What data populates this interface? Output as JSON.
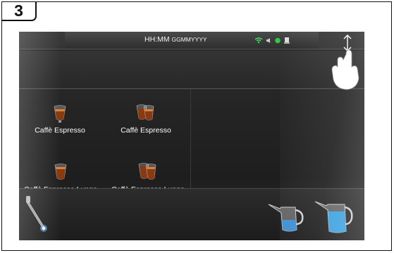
{
  "step": {
    "number": "3"
  },
  "status_bar": {
    "time": "HH:MM",
    "date": "GGMMYYYY",
    "icons": [
      "wifi-icon",
      "sound-icon",
      "status-dot-icon",
      "card-icon"
    ]
  },
  "beverages": [
    {
      "label": "Caffè Espresso"
    },
    {
      "label": "Caffè Espresso"
    },
    {
      "label": "Caffè Espresso Lungo"
    },
    {
      "label": "Caffè Espresso Lungo"
    }
  ],
  "bottom_controls": [
    "steam-wand-icon",
    "hot-milk-jug-icon",
    "hot-water-jug-icon"
  ],
  "gesture": {
    "icon": "swipe-hand-icon"
  },
  "colors": {
    "screen_bg": "#262626",
    "status_green": "#2ecc40",
    "water_blue": "#3aa0e0",
    "frame": "#111111"
  }
}
